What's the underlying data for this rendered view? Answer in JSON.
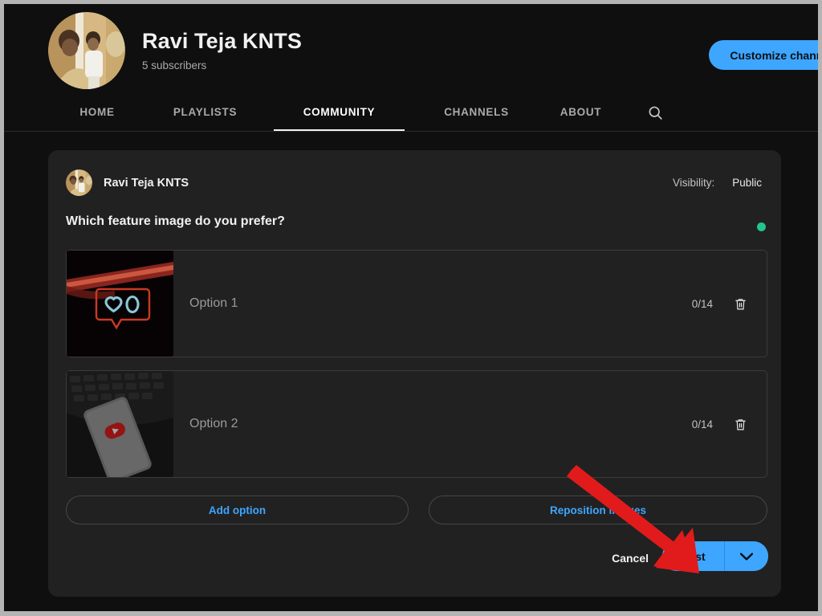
{
  "channel": {
    "name": "Ravi Teja KNTS",
    "subscribers": "5 subscribers",
    "customize_button": "Customize channel",
    "avatar_icon": "channel-avatar-photo"
  },
  "tabs": [
    {
      "label": "HOME",
      "active": false
    },
    {
      "label": "PLAYLISTS",
      "active": false
    },
    {
      "label": "COMMUNITY",
      "active": true
    },
    {
      "label": "CHANNELS",
      "active": false
    },
    {
      "label": "ABOUT",
      "active": false
    }
  ],
  "search": {
    "icon": "search-icon"
  },
  "composer": {
    "author_name": "Ravi Teja KNTS",
    "visibility_label": "Visibility:",
    "visibility_value": "Public",
    "status_dot_color": "#22c58b",
    "question": "Which feature image do you prefer?",
    "options": [
      {
        "placeholder": "Option 1",
        "value": "",
        "char_count": "0/14",
        "delete_icon": "trash-icon",
        "thumbnail": "neon-heart-sign-photo"
      },
      {
        "placeholder": "Option 2",
        "value": "",
        "char_count": "0/14",
        "delete_icon": "trash-icon",
        "thumbnail": "phone-youtube-keyboard-photo"
      }
    ],
    "add_option_label": "Add option",
    "reposition_images_label": "Reposition images",
    "cancel_label": "Cancel",
    "post_label": "Post",
    "post_options_icon": "chevron-down-icon"
  },
  "annotation": {
    "arrow_color": "#e11b1b",
    "target": "post-button"
  },
  "colors": {
    "accent_blue": "#3ea6ff",
    "page_background": "#0f0f0f",
    "card_background": "#212121"
  }
}
